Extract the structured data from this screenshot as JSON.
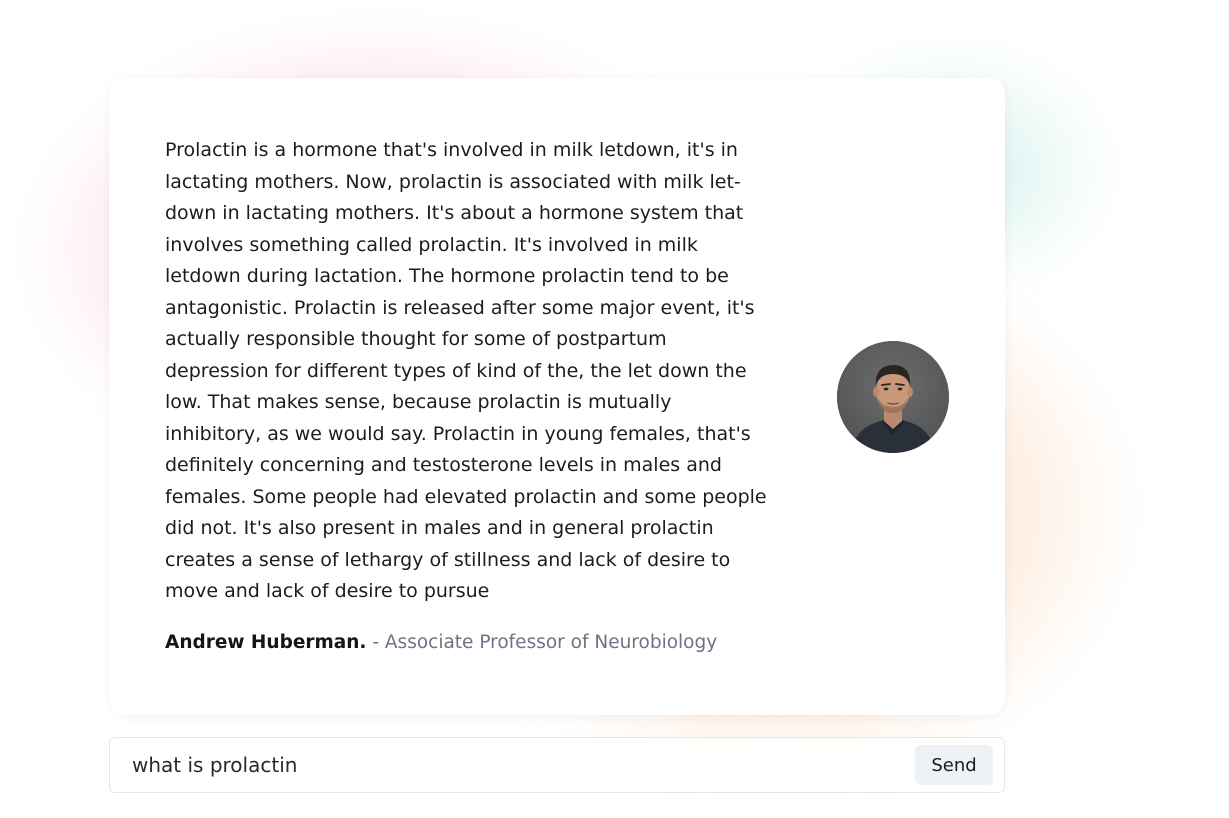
{
  "quote": {
    "text": "Prolactin is a hormone that's involved in milk letdown, it's in lactating mothers. Now, prolactin is associated with milk let-down in lactating mothers. It's about a hormone system that involves something called prolactin. It's involved in milk letdown during lactation. The hormone prolactin tend to be antagonistic. Prolactin is released after some major event, it's actually responsible thought for some of postpartum depression for different types of kind of the, the let down the low. That makes sense, because prolactin is mutually inhibitory, as we would say. Prolactin in young females, that's definitely concerning and testosterone levels in males and females. Some people had elevated prolactin and some people did not. It's also present in males and in general prolactin creates a sense of lethargy of stillness and lack of desire to move and lack of desire to pursue"
  },
  "author": {
    "name": "Andrew Huberman.",
    "role": " - Associate Professor of Neurobiology"
  },
  "chat": {
    "input_value": "what is prolactin",
    "send_label": "Send"
  },
  "colors": {
    "role_text": "#6b7484",
    "send_bg": "#eef1f5",
    "glow_pink": "#f680ba",
    "glow_orange": "#faaa6e",
    "glow_teal": "#96dcd2"
  }
}
